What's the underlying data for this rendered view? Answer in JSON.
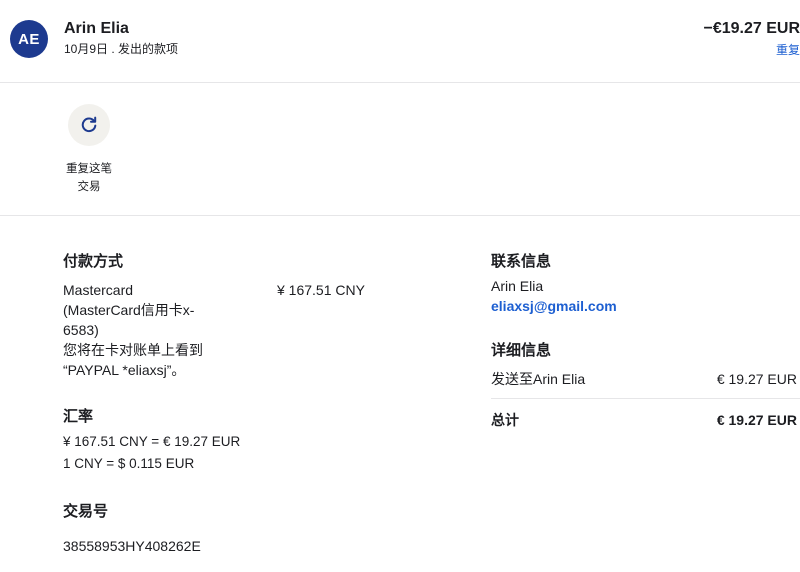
{
  "header": {
    "avatar_initials": "AE",
    "name": "Arin Elia",
    "subtitle": "10月9日 . 发出的款项",
    "amount": "−€19.27 EUR",
    "amount_link": "重复"
  },
  "actions": {
    "repeat_icon": "refresh-icon",
    "repeat_label_line1": "重复这笔",
    "repeat_label_line2": "交易"
  },
  "payment_method": {
    "title": "付款方式",
    "line1": "Mastercard",
    "line2": "(MasterCard信用卡x-",
    "line3": "6583)",
    "line4": "您将在卡对账单上看到",
    "line5": "“PAYPAL *eliaxsj”。",
    "amount": "¥ 167.51 CNY"
  },
  "exchange_rate": {
    "title": "汇率",
    "line1": "¥ 167.51 CNY = € 19.27 EUR",
    "line2": "1 CNY = $ 0.115 EUR"
  },
  "transaction_id": {
    "title": "交易号",
    "value": "38558953HY408262E"
  },
  "contact": {
    "title": "联系信息",
    "name": "Arin Elia",
    "email": "eliaxsj@gmail.com"
  },
  "details": {
    "title": "详细信息",
    "sent_label": "发送至Arin Elia",
    "sent_amount": "€ 19.27 EUR",
    "total_label": "总计",
    "total_amount": "€ 19.27 EUR"
  },
  "colors": {
    "avatar_bg": "#1d3a8f",
    "link": "#1d5fd1",
    "icon_circle_bg": "#f2f1ed"
  }
}
